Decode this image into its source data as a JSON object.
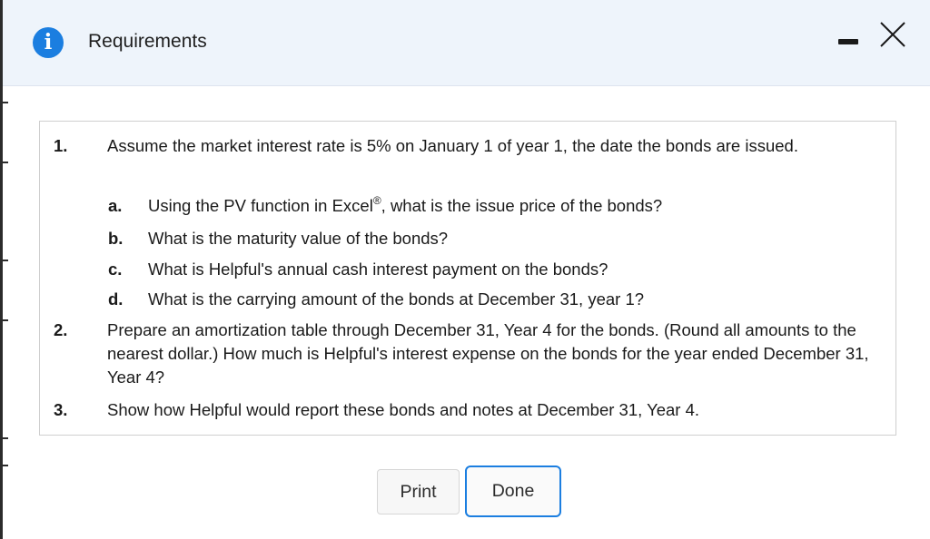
{
  "dialog": {
    "title": "Requirements",
    "info_icon_glyph": "i",
    "icons": {
      "info": "info-icon",
      "minimize": "minimize-icon",
      "close": "close-icon"
    },
    "accent_color": "#1b7ee0"
  },
  "requirements": [
    {
      "number": "1.",
      "text": "Assume the market interest rate is 5% on January 1 of year 1, the date the bonds are issued.",
      "subitems": [
        {
          "label": "a.",
          "text_before": "Using the PV function in Excel",
          "registered": "®",
          "text_after": ", what is the issue price of the bonds?"
        },
        {
          "label": "b.",
          "text": "What is the maturity value of the bonds?"
        },
        {
          "label": "c.",
          "text": "What is Helpful's annual cash interest payment on the bonds?"
        },
        {
          "label": "d.",
          "text": "What is the carrying amount of the bonds at December 31, year 1?"
        }
      ]
    },
    {
      "number": "2.",
      "text": "Prepare an amortization table through December 31, Year 4 for the bonds. (Round all amounts to the nearest dollar.) How much is Helpful's interest expense on the bonds for the year ended December 31, Year 4?"
    },
    {
      "number": "3.",
      "text": "Show how Helpful would report these bonds and notes at December 31, Year 4."
    }
  ],
  "buttons": {
    "print": "Print",
    "done": "Done"
  }
}
